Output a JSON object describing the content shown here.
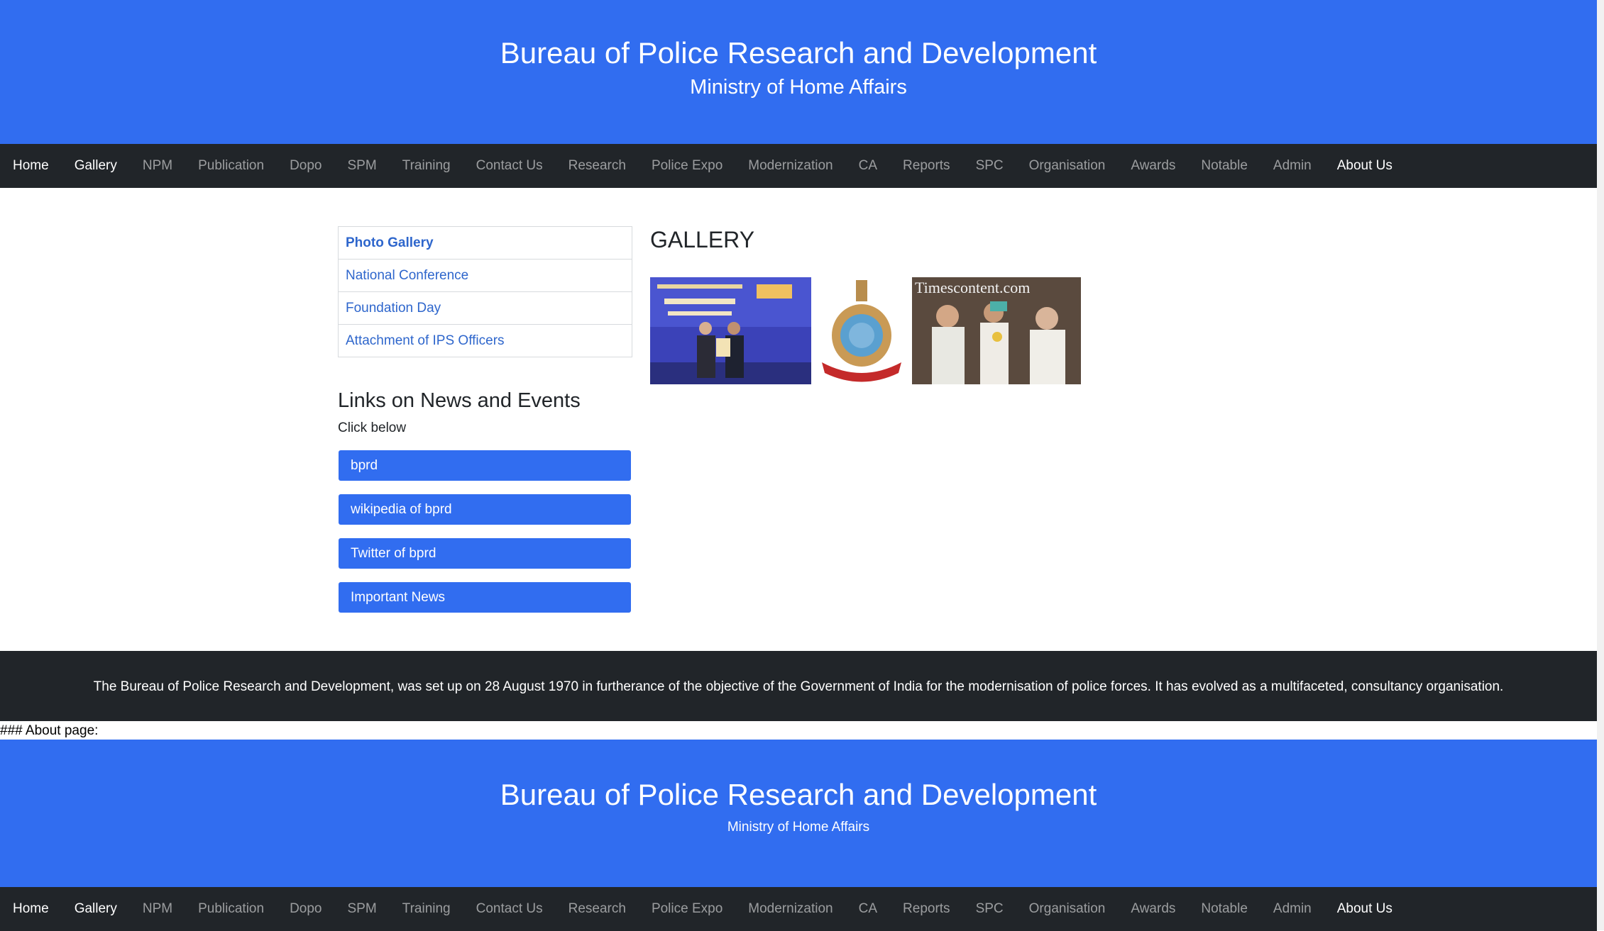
{
  "header": {
    "title": "Bureau of Police Research and Development",
    "subtitle": "Ministry of Home Affairs"
  },
  "nav": [
    {
      "label": "Home",
      "active": true
    },
    {
      "label": "Gallery",
      "active": true
    },
    {
      "label": "NPM",
      "active": false
    },
    {
      "label": "Publication",
      "active": false
    },
    {
      "label": "Dopo",
      "active": false
    },
    {
      "label": "SPM",
      "active": false
    },
    {
      "label": "Training",
      "active": false
    },
    {
      "label": "Contact Us",
      "active": false
    },
    {
      "label": "Research",
      "active": false
    },
    {
      "label": "Police Expo",
      "active": false
    },
    {
      "label": "Modernization",
      "active": false
    },
    {
      "label": "CA",
      "active": false
    },
    {
      "label": "Reports",
      "active": false
    },
    {
      "label": "SPC",
      "active": false
    },
    {
      "label": "Organisation",
      "active": false
    },
    {
      "label": "Awards",
      "active": false
    },
    {
      "label": "Notable",
      "active": false
    },
    {
      "label": "Admin",
      "active": false
    },
    {
      "label": "About Us",
      "active": true
    }
  ],
  "sidebar": {
    "items": [
      "Photo Gallery",
      "National Conference",
      "Foundation Day",
      "Attachment of IPS Officers"
    ]
  },
  "links_section": {
    "heading": "Links on News and Events",
    "subheading": "Click below",
    "buttons": [
      "bprd",
      "wikipedia of bprd",
      "Twitter of bprd",
      "Important News"
    ]
  },
  "gallery": {
    "heading": "GALLERY",
    "watermark": "Timescontent.com"
  },
  "footer": {
    "text": "The Bureau of Police Research and Development, was set up on 28 August 1970 in furtherance of the objective of the Government of India for the modernisation of police forces. It has evolved as a multifaceted, consultancy organisation."
  },
  "about_label": "### About page:",
  "header2": {
    "title": "Bureau of Police Research and Development",
    "subtitle": "Ministry of Home Affairs"
  },
  "colors": {
    "brand_blue": "#316df0",
    "nav_dark": "#212529",
    "link_blue": "#2e66cc"
  }
}
